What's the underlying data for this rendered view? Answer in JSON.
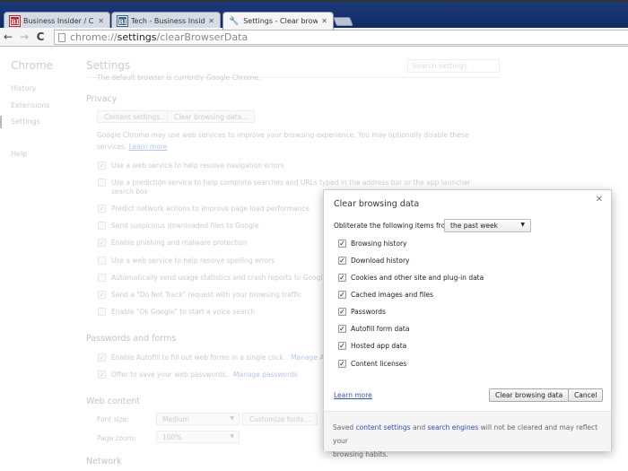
{
  "browser": {
    "tabs": [
      {
        "favicon": "BI",
        "title": "Business Insider / CMS Ed",
        "active": false
      },
      {
        "favicon": "BI",
        "title": "Tech - Business Insider",
        "active": false
      },
      {
        "favicon": "wrench-icon",
        "title": "Settings - Clear browsing",
        "active": true
      }
    ],
    "url_prefix": "chrome://",
    "url_host": "settings",
    "url_path": "/clearBrowserData"
  },
  "sidebar": {
    "brand": "Chrome",
    "items": [
      {
        "label": "History"
      },
      {
        "label": "Extensions"
      },
      {
        "label": "Settings",
        "selected": true
      },
      {
        "label": "Help"
      }
    ]
  },
  "settings": {
    "title": "Settings",
    "search_placeholder": "Search settings",
    "default_browser_text": "The default browser is currently Google Chrome.",
    "privacy": {
      "heading": "Privacy",
      "content_settings_btn": "Content settings...",
      "clear_data_btn": "Clear browsing data...",
      "desc_line1": "Google Chrome may use web services to improve your browsing experience. You may optionally disable these",
      "desc_line2": "services.",
      "learn_more": "Learn more",
      "options": [
        {
          "label": "Use a web service to help resolve navigation errors",
          "checked": true
        },
        {
          "label": "Use a prediction service to help complete searches and URLs typed in the address bar or the app launcher",
          "label2": "search box",
          "checked": false
        },
        {
          "label": "Predict network actions to improve page load performance",
          "checked": true
        },
        {
          "label": "Send suspicious downloaded files to Google",
          "checked": false
        },
        {
          "label": "Enable phishing and malware protection",
          "checked": true
        },
        {
          "label": "Use a web service to help resolve spelling errors",
          "checked": false
        },
        {
          "label": "Automatically send usage statistics and crash reports to Google",
          "checked": false
        },
        {
          "label": "Send a \"Do Not Track\" request with your browsing traffic",
          "checked": true
        },
        {
          "label": "Enable \"Ok Google\" to start a voice search",
          "checked": false
        }
      ]
    },
    "passwords": {
      "heading": "Passwords and forms",
      "autofill_label": "Enable Autofill to fill out web forms in a single click.",
      "autofill_link": "Manage Autofill settings",
      "passwords_label": "Offer to save your web passwords.",
      "passwords_link": "Manage passwords"
    },
    "web_content": {
      "heading": "Web content",
      "font_size_label": "Font size:",
      "font_size_value": "Medium",
      "customize_fonts_btn": "Customize fonts...",
      "page_zoom_label": "Page zoom:",
      "page_zoom_value": "100%"
    },
    "network": {
      "heading": "Network"
    }
  },
  "dialog": {
    "title": "Clear browsing data",
    "obliterate_label": "Obliterate the following items from:",
    "time_range": "the past week",
    "items": [
      {
        "label": "Browsing history",
        "checked": true
      },
      {
        "label": "Download history",
        "checked": true
      },
      {
        "label": "Cookies and other site and plug-in data",
        "checked": true
      },
      {
        "label": "Cached images and files",
        "checked": true
      },
      {
        "label": "Passwords",
        "checked": true
      },
      {
        "label": "Autofill form data",
        "checked": true
      },
      {
        "label": "Hosted app data",
        "checked": true
      },
      {
        "label": "Content licenses",
        "checked": true
      }
    ],
    "learn_more": "Learn more",
    "clear_btn": "Clear browsing data",
    "cancel_btn": "Cancel",
    "footer_pre": "Saved",
    "footer_link1": "content settings",
    "footer_mid": "and",
    "footer_link2": "search engines",
    "footer_post": "will not be cleared and may reflect your",
    "footer_line2": "browsing habits."
  }
}
